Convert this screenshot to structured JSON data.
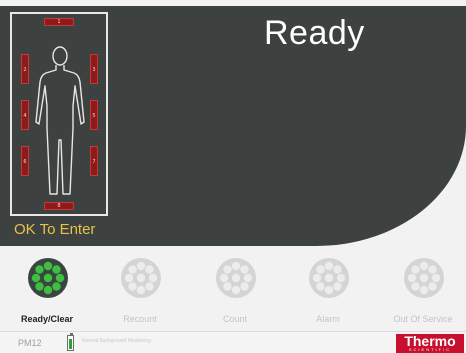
{
  "status": {
    "title": "Ready"
  },
  "entry": {
    "ok_label": "OK To Enter"
  },
  "sensors": [
    {
      "id": "1"
    },
    {
      "id": "2"
    },
    {
      "id": "3"
    },
    {
      "id": "4"
    },
    {
      "id": "5"
    },
    {
      "id": "6"
    },
    {
      "id": "7"
    },
    {
      "id": "8"
    }
  ],
  "buttons": [
    {
      "label": "Ready/Clear",
      "active": true
    },
    {
      "label": "Recount",
      "active": false
    },
    {
      "label": "Count",
      "active": false
    },
    {
      "label": "Alarm",
      "active": false
    },
    {
      "label": "Out Of Service",
      "active": false
    }
  ],
  "footer": {
    "device_id": "PM12",
    "status_text": "Normal Background Monitoring",
    "battery_level": 0.85,
    "brand_name": "Thermo",
    "brand_sub": "SCIENTIFIC"
  },
  "colors": {
    "panel": "#3d4140",
    "sensor": "#8e1a1a",
    "ok_text": "#e8c24a",
    "active_button": "#3a4541",
    "active_dots": "#3fbf3f",
    "inactive_button": "#d4d4d4",
    "brand": "#c8102e"
  }
}
